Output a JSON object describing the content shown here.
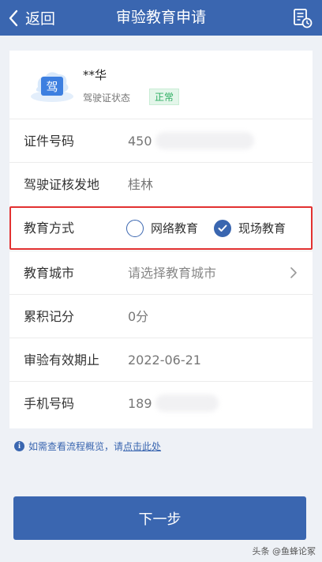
{
  "header": {
    "back_label": "返回",
    "title": "审验教育申请"
  },
  "profile": {
    "name": "**华",
    "status_label": "驾驶证状态",
    "status_badge": "正常",
    "avatar_char": "驾"
  },
  "fields": {
    "id_number": {
      "label": "证件号码",
      "value": "450"
    },
    "issue_place": {
      "label": "驾驶证核发地",
      "value": "桂林"
    },
    "edu_method": {
      "label": "教育方式",
      "option1": "网络教育",
      "option2": "现场教育",
      "selected": "现场教育"
    },
    "edu_city": {
      "label": "教育城市",
      "placeholder": "请选择教育城市"
    },
    "points": {
      "label": "累积记分",
      "value": "0分"
    },
    "valid_until": {
      "label": "审验有效期止",
      "value": "2022-06-21"
    },
    "phone": {
      "label": "手机号码",
      "value": "189"
    }
  },
  "tip": {
    "text": "如需查看流程概览，请",
    "link": "点击此处"
  },
  "next_button": "下一步",
  "watermark": "头条 @鱼蜂论冢",
  "colors": {
    "primary": "#3a66b0",
    "highlight": "#e23131",
    "badge": "#2fae63",
    "background": "#eef1f6"
  }
}
